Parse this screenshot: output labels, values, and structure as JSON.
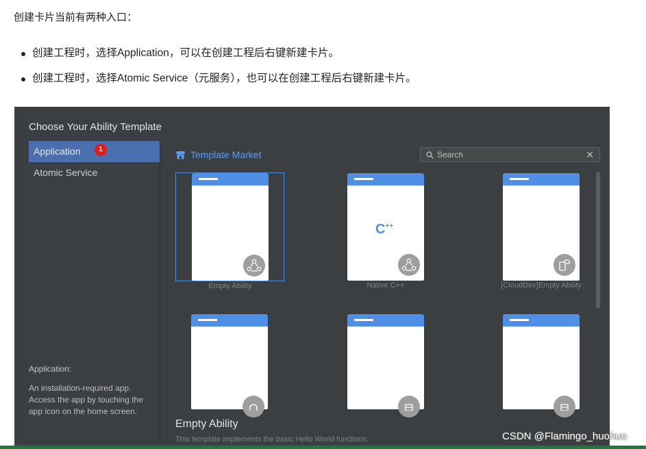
{
  "article": {
    "intro": "创建卡片当前有两种入口：",
    "bullets": [
      "创建工程时，选择Application，可以在创建工程后右键新建卡片。",
      "创建工程时，选择Atomic Service（元服务），也可以在创建工程后右键新建卡片。"
    ]
  },
  "dialog": {
    "title": "Choose Your Ability Template",
    "nav": [
      {
        "label": "Application",
        "badge": "1",
        "active": true
      },
      {
        "label": "Atomic Service",
        "active": false
      }
    ],
    "description": {
      "title": "Application:",
      "text": "An installation-required app. Access the app by touching the app icon on the home screen."
    },
    "market_label": "Template Market",
    "search": {
      "placeholder": "Search",
      "value": ""
    },
    "templates": [
      {
        "label": "Empty Ability",
        "icon": "triangle-nodes-icon",
        "selected": true
      },
      {
        "label": "Native C++",
        "icon": "triangle-nodes-icon",
        "selected": false
      },
      {
        "label": "[CloudDev]Empty Ability",
        "icon": "cloud-device-icon",
        "selected": false
      },
      {
        "label": "",
        "icon": "template-icon",
        "selected": false
      },
      {
        "label": "",
        "icon": "template-icon",
        "selected": false
      },
      {
        "label": "",
        "icon": "template-icon",
        "selected": false
      }
    ],
    "cpp_logo": "C",
    "cpp_logo_sup": "++",
    "detail": {
      "title": "Empty Ability",
      "text": "This template implements the basic Hello World functions."
    }
  },
  "watermark": "CSDN @Flamingo_huohuo",
  "colors": {
    "accent": "#4b6eaf",
    "link": "#589df6",
    "phone_bar": "#4f8fe8",
    "badge": "#e01e1e",
    "panel": "#3c3f41"
  }
}
